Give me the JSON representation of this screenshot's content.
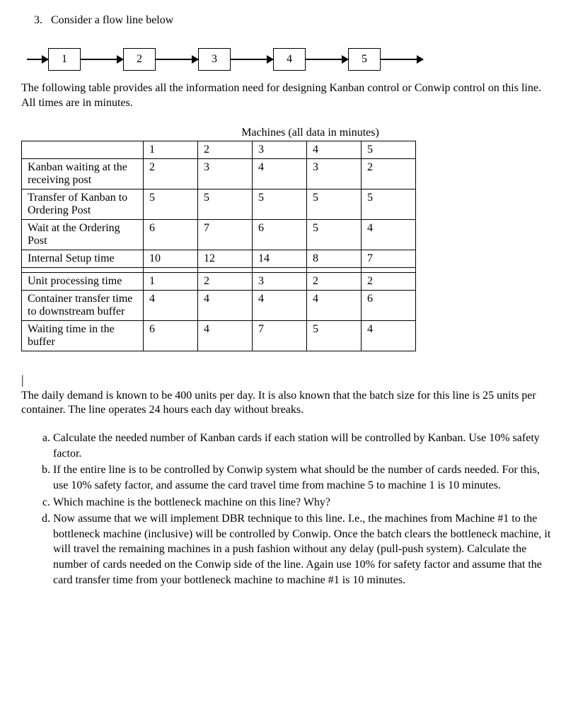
{
  "question_number": "3.",
  "question_prompt": "Consider a flow line below",
  "flow_boxes": [
    "1",
    "2",
    "3",
    "4",
    "5"
  ],
  "intro_text": "The following table provides all the information need for designing Kanban control or Conwip control on this line. All times are in minutes.",
  "table_title": "Machines (all data in minutes)",
  "table": {
    "headers": [
      "",
      "1",
      "2",
      "3",
      "4",
      "5"
    ],
    "rows": [
      {
        "label": "Kanban waiting at the receiving post",
        "values": [
          "2",
          "3",
          "4",
          "3",
          "2"
        ]
      },
      {
        "label": "Transfer of Kanban to Ordering Post",
        "values": [
          "5",
          "5",
          "5",
          "5",
          "5"
        ]
      },
      {
        "label": "Wait at the Ordering Post",
        "values": [
          "6",
          "7",
          "6",
          "5",
          "4"
        ]
      },
      {
        "label": "Internal Setup time",
        "values": [
          "10",
          "12",
          "14",
          "8",
          "7"
        ]
      },
      {
        "label": "Unit processing time",
        "values": [
          "1",
          "2",
          "3",
          "2",
          "2"
        ]
      },
      {
        "label": "Container transfer time to downstream buffer",
        "values": [
          "4",
          "4",
          "4",
          "4",
          "6"
        ]
      },
      {
        "label": "Waiting time in the buffer",
        "values": [
          "6",
          "4",
          "7",
          "5",
          "4"
        ]
      }
    ],
    "spacer_after_row_index": 3
  },
  "demand_text": "The daily demand is known to be 400 units per day. It is also known that the batch size for this line is 25 units per container. The line operates 24 hours each day without breaks.",
  "subparts": [
    "Calculate the needed number of Kanban cards if each station will be controlled by Kanban. Use 10% safety factor.",
    "If the entire line is to be controlled by Conwip system what should be the number of cards needed. For this, use 10% safety factor, and assume the card travel time from machine 5 to machine 1 is 10 minutes.",
    "Which machine is the bottleneck machine on this line? Why?",
    "Now assume that we will implement DBR technique to this line. I.e., the machines from Machine #1 to the bottleneck machine (inclusive) will be controlled by Conwip. Once the batch clears the bottleneck machine, it will travel the remaining machines in a push fashion without any delay (pull-push system). Calculate the number of cards needed on the Conwip side of the line. Again use 10% for safety factor and assume that the card transfer time from your bottleneck machine to machine #1 is 10 minutes."
  ]
}
